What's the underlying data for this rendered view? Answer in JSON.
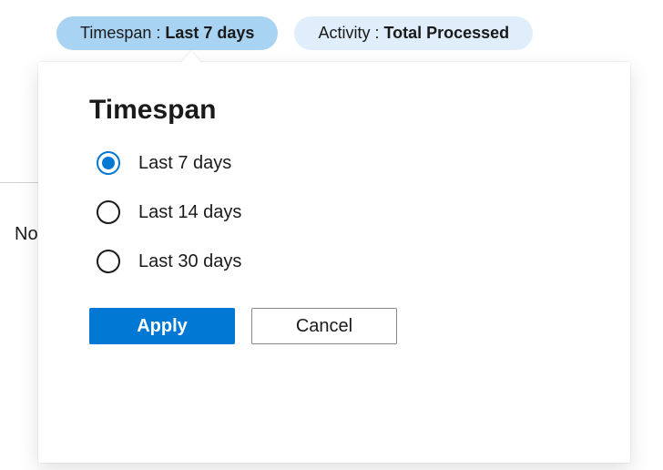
{
  "pills": {
    "timespan": {
      "label": "Timespan : ",
      "value": "Last 7 days"
    },
    "activity": {
      "label": "Activity : ",
      "value": "Total Processed"
    }
  },
  "popup": {
    "title": "Timespan",
    "options": [
      {
        "label": "Last 7 days",
        "selected": true
      },
      {
        "label": "Last 14 days",
        "selected": false
      },
      {
        "label": "Last 30 days",
        "selected": false
      }
    ],
    "apply": "Apply",
    "cancel": "Cancel"
  },
  "background_text": "No"
}
